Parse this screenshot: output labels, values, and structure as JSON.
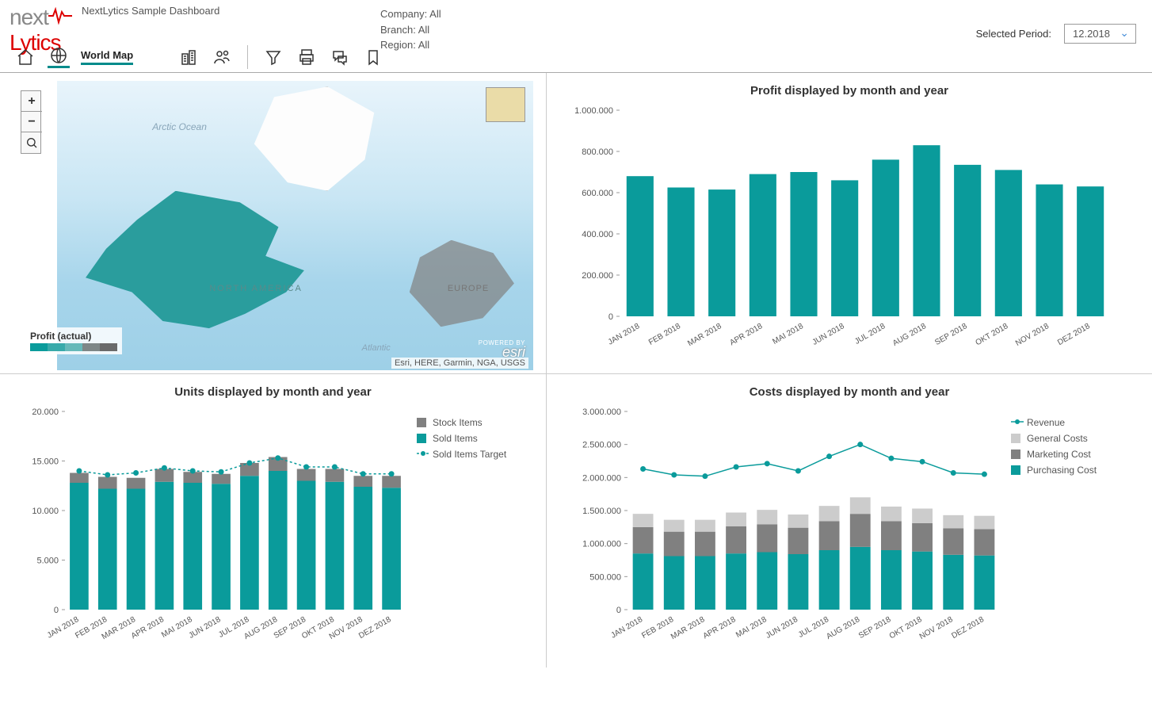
{
  "app": {
    "brand_next": "next",
    "brand_lytics": "Lytics",
    "title": "NextLytics Sample Dashboard"
  },
  "filters": {
    "company": "Company: All",
    "branch": "Branch: All",
    "region": "Region: All"
  },
  "period": {
    "label": "Selected Period:",
    "value": "12.2018"
  },
  "toolbar": {
    "home": "home-icon",
    "world": "globe-icon",
    "world_label": "World Map",
    "buildings": "buildings-icon",
    "people": "people-icon",
    "funnel": "filter-icon",
    "print": "print-icon",
    "chat": "chat-icon",
    "bookmark": "bookmark-icon"
  },
  "map": {
    "arctic_label": "Arctic Ocean",
    "na_label": "NORTH AMERICA",
    "eu_label": "EUROPE",
    "atl_label": "Atlantic",
    "legend_title": "Profit (actual)",
    "ramp": [
      "#0a9b9b",
      "#38aaaa",
      "#66b9b9",
      "#7e8787",
      "#6a6a6a"
    ],
    "attribution": "Esri, HERE, Garmin, NGA, USGS",
    "esri_powered": "POWERED BY",
    "esri_label": "esri"
  },
  "chart_data": [
    {
      "id": "profit",
      "type": "bar",
      "title": "Profit displayed by month and year",
      "categories": [
        "JAN 2018",
        "FEB 2018",
        "MAR 2018",
        "APR 2018",
        "MAI 2018",
        "JUN 2018",
        "JUL 2018",
        "AUG 2018",
        "SEP 2018",
        "OKT 2018",
        "NOV 2018",
        "DEZ 2018"
      ],
      "series": [
        {
          "name": "Profit",
          "color": "#0a9b9b",
          "values": [
            680000,
            625000,
            615000,
            690000,
            700000,
            660000,
            760000,
            830000,
            735000,
            710000,
            640000,
            630000
          ]
        }
      ],
      "ylim": [
        0,
        1000000
      ],
      "yticks": [
        0,
        200000,
        400000,
        600000,
        800000,
        1000000
      ],
      "ytick_labels": [
        "0",
        "200.000",
        "400.000",
        "600.000",
        "800.000",
        "1.000.000"
      ]
    },
    {
      "id": "units",
      "type": "stacked-bar-line",
      "title": "Units displayed by month and year",
      "categories": [
        "JAN 2018",
        "FEB 2018",
        "MAR 2018",
        "APR 2018",
        "MAI 2018",
        "JUN 2018",
        "JUL 2018",
        "AUG 2018",
        "SEP 2018",
        "OKT 2018",
        "NOV 2018",
        "DEZ 2018"
      ],
      "series": [
        {
          "name": "Sold Items",
          "color": "#0a9b9b",
          "values": [
            12800,
            12200,
            12200,
            12900,
            12800,
            12700,
            13500,
            14000,
            13000,
            12900,
            12400,
            12300
          ]
        },
        {
          "name": "Stock Items",
          "color": "#808080",
          "values": [
            1000,
            1200,
            1100,
            1300,
            1100,
            1000,
            1300,
            1400,
            1200,
            1300,
            1100,
            1200
          ]
        },
        {
          "name": "Sold Items Target",
          "kind": "line",
          "color": "#0a9b9b",
          "values": [
            14000,
            13600,
            13800,
            14300,
            14000,
            13900,
            14800,
            15300,
            14400,
            14400,
            13700,
            13700
          ]
        }
      ],
      "legend": [
        "Stock Items",
        "Sold Items",
        "Sold Items Target"
      ],
      "ylim": [
        0,
        20000
      ],
      "yticks": [
        0,
        5000,
        10000,
        15000,
        20000
      ],
      "ytick_labels": [
        "0",
        "5.000",
        "10.000",
        "15.000",
        "20.000"
      ]
    },
    {
      "id": "costs",
      "type": "stacked-bar-line",
      "title": "Costs displayed by month and year",
      "categories": [
        "JAN 2018",
        "FEB 2018",
        "MAR 2018",
        "APR 2018",
        "MAI 2018",
        "JUN 2018",
        "JUL 2018",
        "AUG 2018",
        "SEP 2018",
        "OKT 2018",
        "NOV 2018",
        "DEZ 2018"
      ],
      "series": [
        {
          "name": "Purchasing Cost",
          "color": "#0a9b9b",
          "values": [
            850000,
            810000,
            810000,
            850000,
            870000,
            840000,
            900000,
            950000,
            900000,
            880000,
            830000,
            820000
          ]
        },
        {
          "name": "Marketing Cost",
          "color": "#808080",
          "values": [
            400000,
            370000,
            370000,
            410000,
            420000,
            400000,
            440000,
            500000,
            440000,
            430000,
            400000,
            400000
          ]
        },
        {
          "name": "General Costs",
          "color": "#cccccc",
          "values": [
            200000,
            180000,
            180000,
            210000,
            220000,
            200000,
            230000,
            250000,
            220000,
            220000,
            200000,
            200000
          ]
        },
        {
          "name": "Revenue",
          "kind": "line",
          "color": "#0a9b9b",
          "values": [
            2130000,
            2040000,
            2020000,
            2160000,
            2210000,
            2100000,
            2320000,
            2500000,
            2290000,
            2240000,
            2070000,
            2050000
          ]
        }
      ],
      "legend": [
        "Revenue",
        "General Costs",
        "Marketing Cost",
        "Purchasing Cost"
      ],
      "ylim": [
        0,
        3000000
      ],
      "yticks": [
        0,
        500000,
        1000000,
        1500000,
        2000000,
        2500000,
        3000000
      ],
      "ytick_labels": [
        "0",
        "500.000",
        "1.000.000",
        "1.500.000",
        "2.000.000",
        "2.500.000",
        "3.000.000"
      ]
    }
  ]
}
